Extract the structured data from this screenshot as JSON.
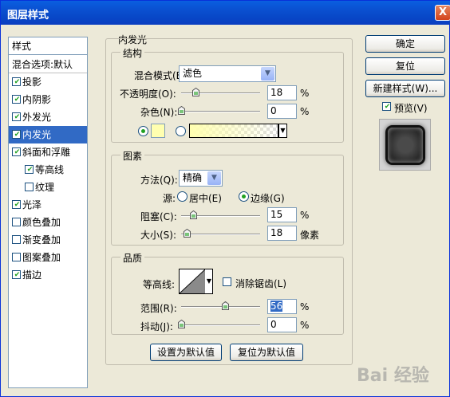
{
  "window": {
    "title": "图层样式",
    "close_glyph": "X"
  },
  "sidebar": {
    "header": "样式",
    "blend_options": "混合选项:默认",
    "items": [
      {
        "label": "投影",
        "checked": true,
        "selected": false,
        "indent": false
      },
      {
        "label": "内阴影",
        "checked": true,
        "selected": false,
        "indent": false
      },
      {
        "label": "外发光",
        "checked": true,
        "selected": false,
        "indent": false
      },
      {
        "label": "内发光",
        "checked": true,
        "selected": true,
        "indent": false
      },
      {
        "label": "斜面和浮雕",
        "checked": true,
        "selected": false,
        "indent": false
      },
      {
        "label": "等高线",
        "checked": true,
        "selected": false,
        "indent": true
      },
      {
        "label": "纹理",
        "checked": false,
        "selected": false,
        "indent": true
      },
      {
        "label": "光泽",
        "checked": true,
        "selected": false,
        "indent": false
      },
      {
        "label": "颜色叠加",
        "checked": false,
        "selected": false,
        "indent": false
      },
      {
        "label": "渐变叠加",
        "checked": false,
        "selected": false,
        "indent": false
      },
      {
        "label": "图案叠加",
        "checked": false,
        "selected": false,
        "indent": false
      },
      {
        "label": "描边",
        "checked": true,
        "selected": false,
        "indent": false
      }
    ]
  },
  "panel": {
    "title": "内发光",
    "structure": {
      "title": "结构",
      "blend_mode_label": "混合模式(B):",
      "blend_mode_value": "滤色",
      "opacity_label": "不透明度(O):",
      "opacity_value": "18",
      "opacity_level": 18,
      "noise_label": "杂色(N):",
      "noise_value": "0",
      "noise_level": 0,
      "pct": "%",
      "swatch_color": "#ffffb0"
    },
    "elements": {
      "title": "图素",
      "method_label": "方法(Q):",
      "method_value": "精确",
      "source_label": "源:",
      "source_center": "居中(E)",
      "source_edge": "边缘(G)",
      "choke_label": "阻塞(C):",
      "choke_value": "15",
      "choke_level": 15,
      "size_label": "大小(S):",
      "size_value": "18",
      "size_unit": "像素"
    },
    "quality": {
      "title": "品质",
      "contour_label": "等高线:",
      "antialias_label": "消除锯齿(L)",
      "range_label": "范围(R):",
      "range_value": "56",
      "range_level": 56,
      "jitter_label": "抖动(J):",
      "jitter_value": "0",
      "jitter_level": 0
    },
    "set_default": "设置为默认值",
    "reset_default": "复位为默认值"
  },
  "right": {
    "ok": "确定",
    "reset": "复位",
    "new_style": "新建样式(W)...",
    "preview_label": "预览(V)",
    "preview_checked": true
  },
  "watermark": "Bai 经验",
  "colors": {
    "selection": "#316ac5",
    "accent_green": "#21a121"
  }
}
